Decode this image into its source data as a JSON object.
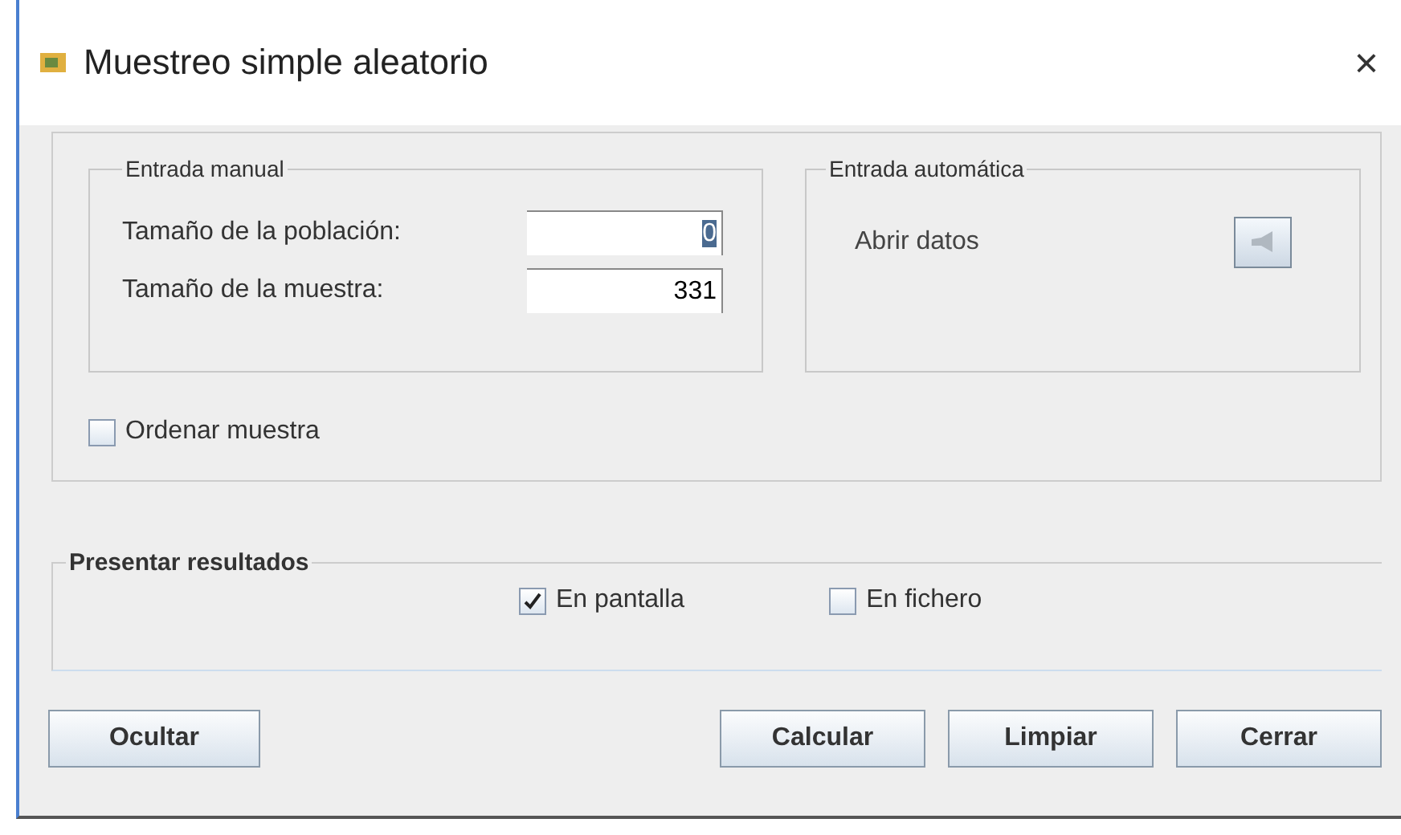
{
  "window": {
    "title": "Muestreo simple aleatorio",
    "close": "×"
  },
  "manual": {
    "title": "Entrada manual",
    "fields": [
      {
        "label": "Tamaño de la población:",
        "value": "0",
        "focused": true
      },
      {
        "label": "Tamaño de la muestra:",
        "value": "331",
        "focused": false
      }
    ]
  },
  "auto": {
    "title": "Entrada automática",
    "label": "Abrir datos"
  },
  "sort": {
    "label": "Ordenar muestra",
    "checked": false
  },
  "results": {
    "title": "Presentar resultados",
    "options": [
      {
        "label": "En pantalla",
        "checked": true
      },
      {
        "label": "En fichero",
        "checked": false
      }
    ]
  },
  "buttons": [
    {
      "label": "Ocultar",
      "kind": "left"
    },
    {
      "label": "Calcular",
      "kind": "right"
    },
    {
      "label": "Limpiar",
      "kind": "right"
    },
    {
      "label": "Cerrar",
      "kind": "right"
    }
  ]
}
